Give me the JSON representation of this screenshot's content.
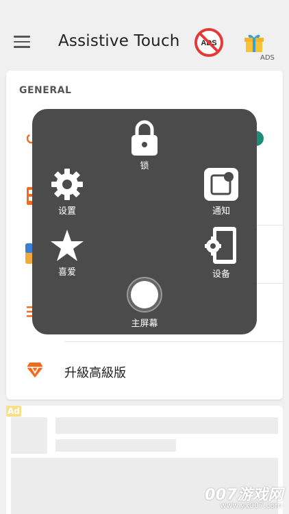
{
  "app": {
    "title": "Assistive Touch",
    "ads_label": "ADS",
    "no_ads_text": "ADS"
  },
  "general": {
    "heading": "GENERAL",
    "upgrade_label": "升級高級版"
  },
  "ad": {
    "badge": "Ad"
  },
  "overlay": {
    "lock_label": "锁",
    "settings_label": "设置",
    "notify_label": "通知",
    "favorite_label": "喜爱",
    "device_label": "设备",
    "home_label": "主屏幕"
  },
  "watermark": {
    "brand": "007游戏网",
    "url": "www.yx007.com"
  },
  "colors": {
    "accent_orange": "#f26b1d",
    "overlay_bg": "#4b4b4b",
    "no_ads_red": "#e53935",
    "toggle_teal": "#1f8a78"
  }
}
